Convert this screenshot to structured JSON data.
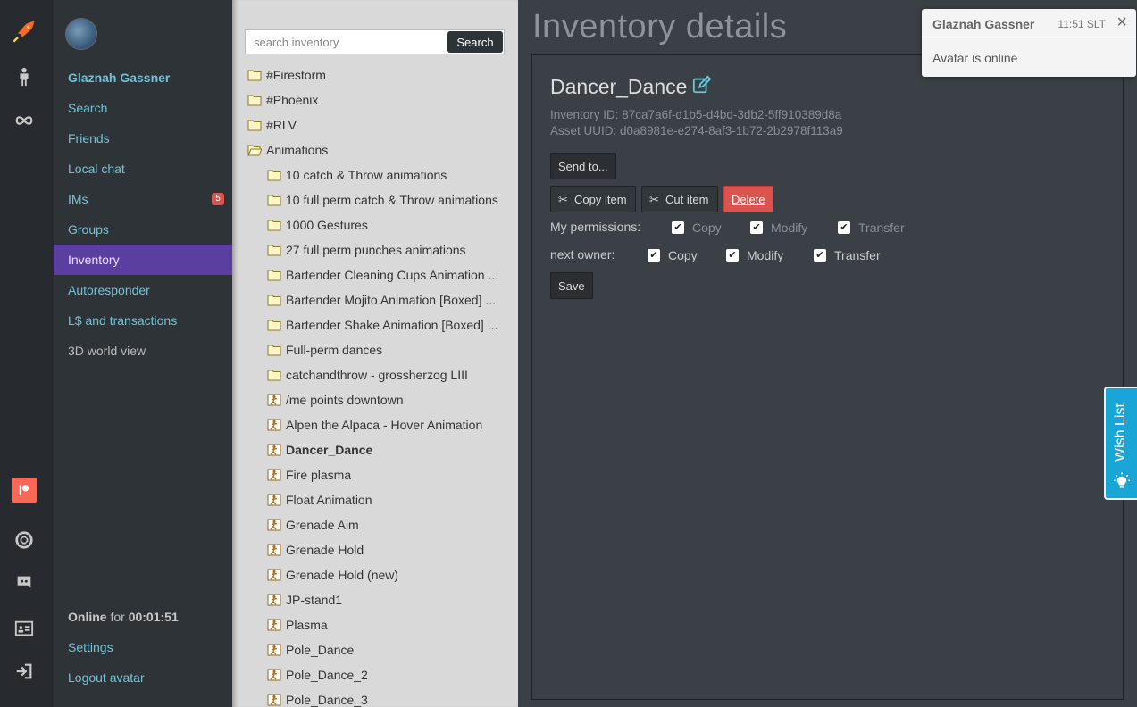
{
  "rail": {
    "icons": [
      "rocket-icon",
      "person-icon",
      "infinity-icon",
      "patreon-icon",
      "lifebuoy-icon",
      "discord-icon",
      "id-card-icon",
      "logout-icon"
    ],
    "patreon_color": "#f96854"
  },
  "sidebar": {
    "user_name": "Glaznah Gassner",
    "items": [
      {
        "label": "Search"
      },
      {
        "label": "Friends"
      },
      {
        "label": "Local chat"
      },
      {
        "label": "IMs",
        "badge": "5"
      },
      {
        "label": "Groups"
      },
      {
        "label": "Inventory",
        "active": true
      },
      {
        "label": "Autoresponder"
      },
      {
        "label": "L$ and transactions"
      },
      {
        "label": "3D world view"
      }
    ],
    "status": {
      "state": "Online",
      "for_label": "for",
      "duration": "00:01:51"
    },
    "settings_label": "Settings",
    "logout_label": "Logout avatar",
    "active_color": "#5b3fa0"
  },
  "inventory": {
    "search": {
      "placeholder": "search inventory",
      "button_label": "Search"
    },
    "tree": [
      {
        "label": "#Firestorm",
        "type": "folder"
      },
      {
        "label": "#Phoenix",
        "type": "folder"
      },
      {
        "label": "#RLV",
        "type": "folder"
      },
      {
        "label": "Animations",
        "type": "folder-open"
      },
      {
        "label": "10 catch & Throw animations",
        "type": "folder"
      },
      {
        "label": "10 full perm catch & Throw animations",
        "type": "folder"
      },
      {
        "label": "1000 Gestures",
        "type": "folder"
      },
      {
        "label": "27 full perm punches animations",
        "type": "folder"
      },
      {
        "label": "Bartender Cleaning Cups Animation ...",
        "type": "folder"
      },
      {
        "label": "Bartender Mojito Animation [Boxed] ...",
        "type": "folder"
      },
      {
        "label": "Bartender Shake Animation [Boxed] ...",
        "type": "folder"
      },
      {
        "label": "Full-perm dances",
        "type": "folder"
      },
      {
        "label": "catchandthrow - grossherzog LIII",
        "type": "folder"
      },
      {
        "label": "/me points downtown",
        "type": "animation"
      },
      {
        "label": "Alpen the Alpaca - Hover Animation",
        "type": "animation"
      },
      {
        "label": "Dancer_Dance",
        "type": "animation",
        "selected": true
      },
      {
        "label": "Fire plasma",
        "type": "animation"
      },
      {
        "label": "Float Animation",
        "type": "animation"
      },
      {
        "label": "Grenade Aim",
        "type": "animation"
      },
      {
        "label": "Grenade Hold",
        "type": "animation"
      },
      {
        "label": "Grenade Hold (new)",
        "type": "animation"
      },
      {
        "label": "JP-stand1",
        "type": "animation"
      },
      {
        "label": "Plasma",
        "type": "animation"
      },
      {
        "label": "Pole_Dance",
        "type": "animation"
      },
      {
        "label": "Pole_Dance_2",
        "type": "animation"
      },
      {
        "label": "Pole_Dance_3",
        "type": "animation"
      }
    ]
  },
  "details": {
    "page_title": "Inventory details",
    "item_name": "Dancer_Dance",
    "inventory_id": "Inventory ID: 87ca7a6f-d1b5-d4bd-3db2-5ff910389d8a",
    "asset_uuid": "Asset UUID: d0a8981e-e274-8af3-1b72-2b2978f113a9",
    "send_to_label": "Send to...",
    "copy_item_label": "Copy item",
    "cut_item_label": "Cut item",
    "delete_label": "Delete",
    "my_permissions_label": "My permissions:",
    "next_owner_label": "next owner:",
    "my_permissions": [
      {
        "label": "Copy",
        "checked": true
      },
      {
        "label": "Modify",
        "checked": true
      },
      {
        "label": "Transfer",
        "checked": true
      }
    ],
    "next_owner_permissions": [
      {
        "label": "Copy",
        "checked": true
      },
      {
        "label": "Modify",
        "checked": true
      },
      {
        "label": "Transfer",
        "checked": true
      }
    ],
    "save_label": "Save",
    "delete_color": "#d9534f"
  },
  "toast": {
    "title": "Glaznah Gassner",
    "time": "11:51 SLT",
    "close": "×",
    "message": "Avatar is online"
  },
  "wishlist": {
    "label": "Wish List",
    "icon": "lightbulb-icon",
    "color": "#19a5d6"
  }
}
